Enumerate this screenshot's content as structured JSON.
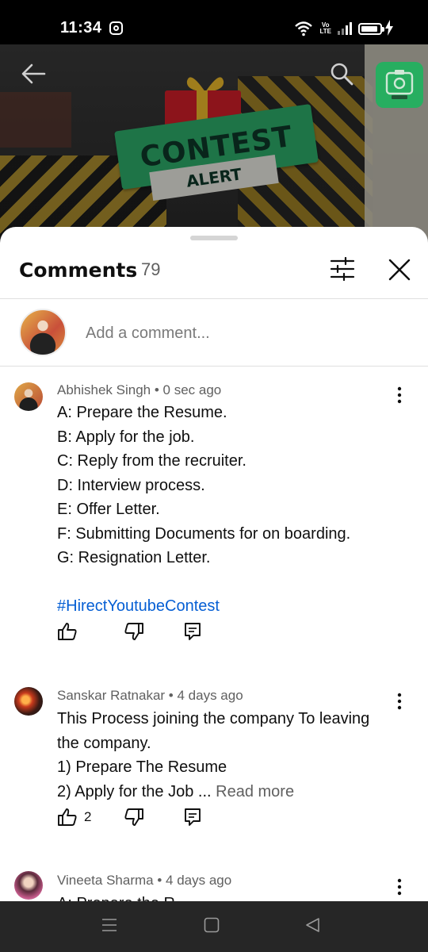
{
  "status_bar": {
    "time": "11:34",
    "network_label_top": "Vo",
    "network_label_bottom": "LTE",
    "icons": [
      "instagram-icon",
      "wifi-icon",
      "volte-icon",
      "signal-icon",
      "battery-icon",
      "charging-icon"
    ]
  },
  "video": {
    "banner_text": "CONTEST",
    "ribbon_text": "ALERT",
    "icons": [
      "back-arrow-icon",
      "search-icon",
      "camera-icon"
    ],
    "accent": "#2fb36e"
  },
  "sheet": {
    "title": "Comments",
    "count": "79",
    "icons": [
      "filter-icon",
      "close-icon"
    ]
  },
  "add_comment": {
    "placeholder": "Add a comment..."
  },
  "comments": [
    {
      "author": "Abhishek Singh",
      "time": "0 sec ago",
      "lines": [
        "A: Prepare the Resume.",
        "B: Apply for the job.",
        "C: Reply from the recruiter.",
        "D: Interview process.",
        "E: Offer Letter.",
        "F: Submitting Documents for on boarding.",
        "G: Resignation Letter."
      ],
      "hashtag": "#HirectYoutubeContest",
      "likes": ""
    },
    {
      "author": "Sanskar Ratnakar",
      "time": "4 days ago",
      "lines": [
        "This Process joining the company To leaving",
        "the company.",
        "1) Prepare The Resume",
        "2) Apply for the Job ..."
      ],
      "read_more": "Read more",
      "likes": "2"
    },
    {
      "author": "Vineeta Sharma",
      "time": "4 days ago",
      "partial_line": "A: Prepare the R"
    }
  ],
  "separator": " • ",
  "link_color": "#065fd4",
  "nav_bar": {
    "icons": [
      "menu-icon",
      "home-icon",
      "back-icon"
    ]
  }
}
